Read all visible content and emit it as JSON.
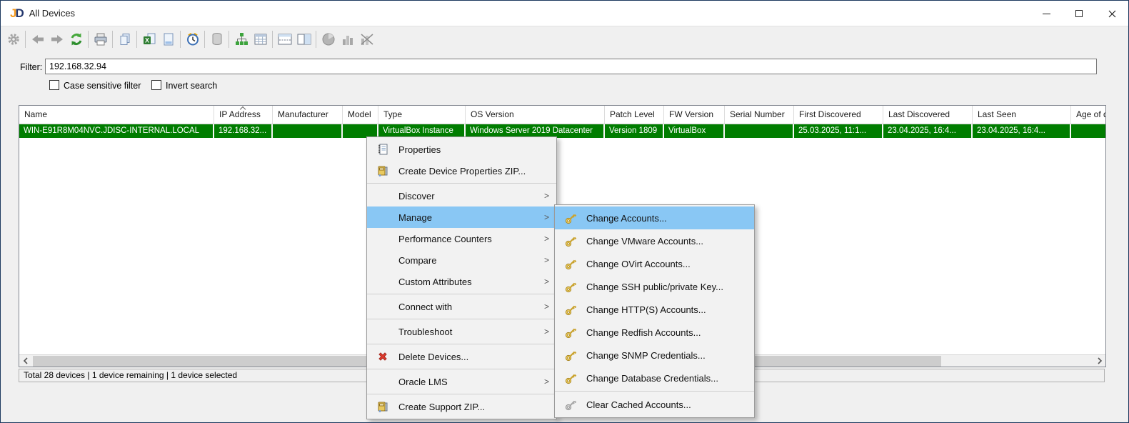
{
  "window": {
    "title": "All Devices",
    "logo": {
      "j": "J",
      "d": "D"
    }
  },
  "colors": {
    "selection_green": "#007d00",
    "menu_highlight": "#89c7f4",
    "logo_orange": "#f59a1f",
    "logo_navy": "#24386e"
  },
  "toolbar": {
    "icons": [
      "settings-icon",
      "back-icon",
      "forward-icon",
      "refresh-icon",
      "print-icon",
      "copy-icon",
      "export-excel-icon",
      "export-document-icon",
      "scheduler-icon",
      "database-icon",
      "topology-icon",
      "table-view-icon",
      "split-horizontal-icon",
      "split-vertical-icon",
      "pie-chart-icon",
      "bar-chart-icon",
      "no-chart-icon"
    ]
  },
  "filter": {
    "label": "Filter:",
    "value": "192.168.32.94",
    "case_sensitive_label": "Case sensitive filter",
    "case_sensitive_checked": false,
    "invert_label": "Invert search",
    "invert_checked": false
  },
  "table": {
    "sorted_column": "IP Address",
    "sort_direction": "asc",
    "columns": [
      "Name",
      "IP Address",
      "Manufacturer",
      "Model",
      "Type",
      "OS Version",
      "Patch Level",
      "FW Version",
      "Serial Number",
      "First Discovered",
      "Last Discovered",
      "Last Seen",
      "Age of d"
    ],
    "row": [
      "WIN-E91R8M04NVC.JDISC-INTERNAL.LOCAL",
      "192.168.32...",
      "",
      "",
      "VirtualBox Instance",
      "Windows Server 2019 Datacenter",
      "Version 1809",
      "VirtualBox",
      "",
      "25.03.2025, 11:1...",
      "23.04.2025, 16:4...",
      "23.04.2025, 16:4...",
      ""
    ]
  },
  "status_bar": {
    "text": "Total 28 devices | 1 device remaining | 1 device selected"
  },
  "context_menu": {
    "properties": "Properties",
    "create_device_zip": "Create Device Properties ZIP...",
    "discover": "Discover",
    "manage": "Manage",
    "performance_counters": "Performance Counters",
    "compare": "Compare",
    "custom_attributes": "Custom Attributes",
    "connect_with": "Connect with",
    "troubleshoot": "Troubleshoot",
    "delete_devices": "Delete Devices...",
    "oracle_lms": "Oracle LMS",
    "create_support_zip": "Create Support ZIP..."
  },
  "manage_submenu": {
    "change_accounts": "Change Accounts...",
    "change_vmware": "Change VMware Accounts...",
    "change_ovirt": "Change OVirt Accounts...",
    "change_ssh": "Change SSH public/private Key...",
    "change_https": "Change HTTP(S) Accounts...",
    "change_redfish": "Change Redfish Accounts...",
    "change_snmp": "Change SNMP Credentials...",
    "change_database": "Change Database Credentials...",
    "clear_cached": "Clear Cached Accounts..."
  }
}
